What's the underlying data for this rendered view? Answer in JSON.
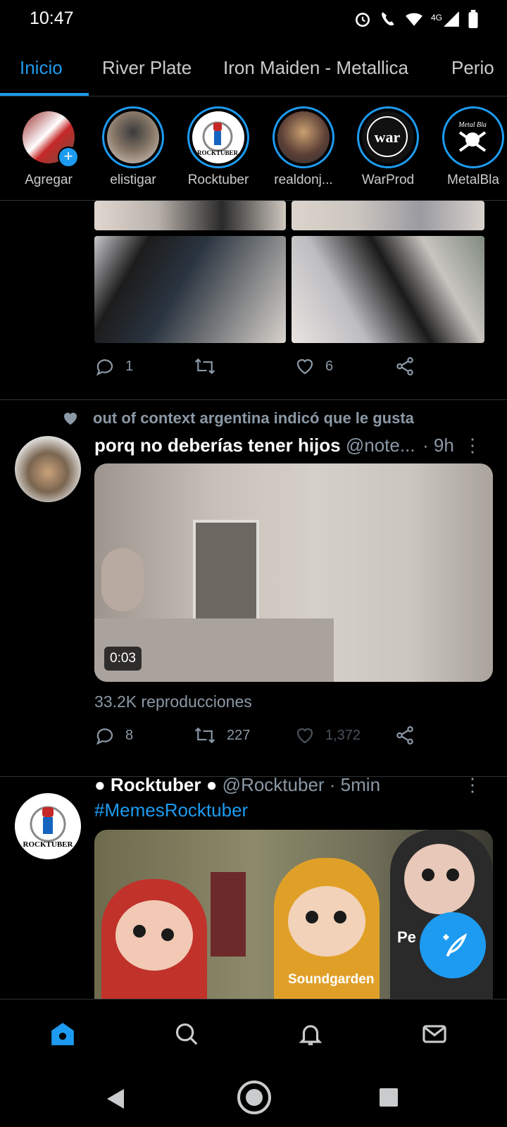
{
  "status_bar": {
    "time": "10:47",
    "network": "4G"
  },
  "tabs": [
    "Inicio",
    "River Plate",
    "Iron Maiden - Metallica",
    "Perio"
  ],
  "stories": [
    {
      "name": "Agregar"
    },
    {
      "name": "elistigar"
    },
    {
      "name": "Rocktuber",
      "logo_text": "ROCKTUBER"
    },
    {
      "name": "realdonj..."
    },
    {
      "name": "WarProd",
      "logo_text": "war"
    },
    {
      "name": "MetalBla",
      "logo_text": "Metal Bla"
    }
  ],
  "post1": {
    "replies": "1",
    "likes": "6"
  },
  "post2": {
    "liked_by": "out of context argentina indicó que le gusta",
    "name": "porq no deberías tener hijos",
    "handle": "@note...",
    "time": "· 9h",
    "duration": "0:03",
    "views": "33.2K reproducciones",
    "replies": "8",
    "retweets": "227",
    "likes": "1,372"
  },
  "post3": {
    "name": "● Rocktuber ●",
    "handle": "@Rocktuber · 5min",
    "hashtag": "#MemesRocktuber",
    "avatar_text": "ROCKTUBER",
    "image_caption": "Soundgarden",
    "image_caption_cut": "Pe"
  },
  "colors": {
    "accent": "#1d9bf0",
    "background": "#000000",
    "muted": "#8b98a5"
  },
  "icons": [
    "alarm-icon",
    "wifi-call-icon",
    "wifi-icon",
    "signal-icon",
    "battery-icon",
    "reply-icon",
    "retweet-icon",
    "like-icon",
    "share-icon",
    "more-icon",
    "home-icon",
    "search-icon",
    "bell-icon",
    "mail-icon",
    "compose-icon"
  ]
}
